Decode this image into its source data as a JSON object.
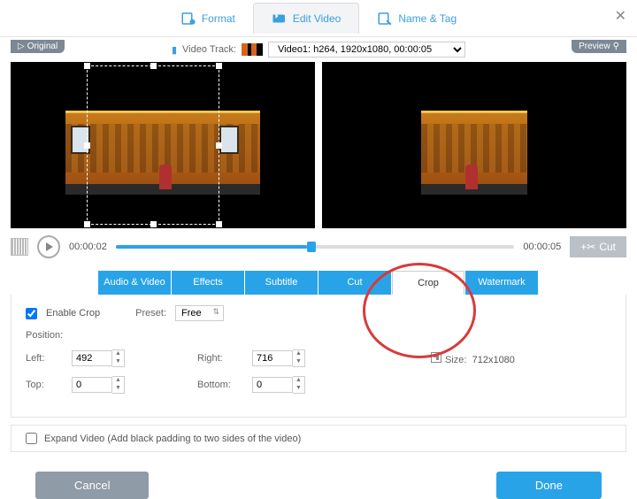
{
  "top_tabs": {
    "format": "Format",
    "edit": "Edit Video",
    "name": "Name & Tag"
  },
  "close": "✕",
  "track": {
    "label": "Video Track:",
    "selected": "Video1: h264, 1920x1080, 00:00:05"
  },
  "badges": {
    "original": "Original",
    "preview": "Preview"
  },
  "timeline": {
    "elapsed": "00:00:02",
    "total": "00:00:05",
    "cut": "Cut"
  },
  "edit_tabs": [
    "Audio & Video",
    "Effects",
    "Subtitle",
    "Cut",
    "Crop",
    "Watermark"
  ],
  "crop": {
    "enable_label": "Enable Crop",
    "preset_label": "Preset:",
    "preset_value": "Free",
    "position_label": "Position:",
    "left_label": "Left:",
    "left": "492",
    "right_label": "Right:",
    "right": "716",
    "top_label": "Top:",
    "top": "0",
    "bottom_label": "Bottom:",
    "bottom": "0",
    "size_label": "Size:",
    "size": "712x1080"
  },
  "expand": {
    "label": "Expand Video (Add black padding to two sides of the video)"
  },
  "footer": {
    "cancel": "Cancel",
    "done": "Done"
  },
  "preview_icon": "⚲"
}
